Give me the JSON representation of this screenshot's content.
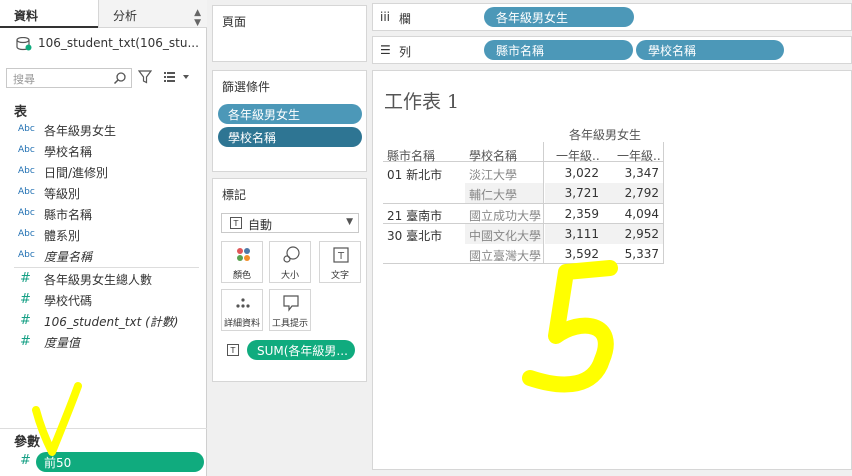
{
  "data_pane": {
    "tab_data": "資料",
    "tab_analysis": "分析",
    "datasource": "106_student_txt(106_stu...",
    "search_placeholder": "搜尋",
    "tables_title": "表",
    "dimensions": [
      {
        "type": "Abc",
        "name": "各年級男女生"
      },
      {
        "type": "Abc",
        "name": "學校名稱"
      },
      {
        "type": "Abc",
        "name": "日間/進修別"
      },
      {
        "type": "Abc",
        "name": "等級別"
      },
      {
        "type": "Abc",
        "name": "縣市名稱"
      },
      {
        "type": "Abc",
        "name": "體系別"
      },
      {
        "type": "Abc",
        "name": "度量名稱"
      }
    ],
    "measures": [
      {
        "type": "#",
        "name": "各年級男女生總人數"
      },
      {
        "type": "#",
        "name": "學校代碼"
      },
      {
        "type": "#",
        "name": "106_student_txt (計數)"
      },
      {
        "type": "#",
        "name": "度量值"
      }
    ],
    "params_title": "參數",
    "param": {
      "type": "#",
      "name": "前50"
    }
  },
  "pages_card": {
    "title": "頁面"
  },
  "filters_card": {
    "title": "篩選條件",
    "pills": [
      "各年級男女生",
      "學校名稱"
    ]
  },
  "marks_card": {
    "title": "標記",
    "mark_type": "自動",
    "mark_type_icon": "T",
    "buttons": [
      {
        "label": "顏色",
        "icon": "color-dots-icon"
      },
      {
        "label": "大小",
        "icon": "size-icon"
      },
      {
        "label": "文字",
        "icon": "text-icon"
      },
      {
        "label": "詳細資料",
        "icon": "detail-icon"
      },
      {
        "label": "工具提示",
        "icon": "tooltip-icon"
      }
    ],
    "field_pill": "SUM(各年級男...",
    "field_pill_icon": "T"
  },
  "shelves": {
    "columns": {
      "icon": "iii",
      "label": "欄",
      "pills": [
        "各年級男女生"
      ]
    },
    "rows": {
      "icon": "☰",
      "label": "列",
      "pills": [
        "縣市名稱",
        "學校名稱"
      ]
    }
  },
  "sheet": {
    "title": "工作表 1",
    "col_group_header": "各年級男女生",
    "headers": [
      "縣市名稱",
      "學校名稱",
      "一年級..",
      "一年級.."
    ],
    "rows": [
      {
        "city": "01 新北市",
        "school": "淡江大學",
        "v1": "3,022",
        "v2": "3,347"
      },
      {
        "city": "",
        "school": "輔仁大學",
        "v1": "3,721",
        "v2": "2,792"
      },
      {
        "city": "21 臺南市",
        "school": "國立成功大學",
        "v1": "2,359",
        "v2": "4,094"
      },
      {
        "city": "30 臺北市",
        "school": "中國文化大學",
        "v1": "3,111",
        "v2": "2,952"
      },
      {
        "city": "",
        "school": "國立臺灣大學",
        "v1": "3,592",
        "v2": "5,337"
      }
    ]
  },
  "annotations": {
    "handwritten_digit": "5",
    "color": "#ffff00"
  }
}
